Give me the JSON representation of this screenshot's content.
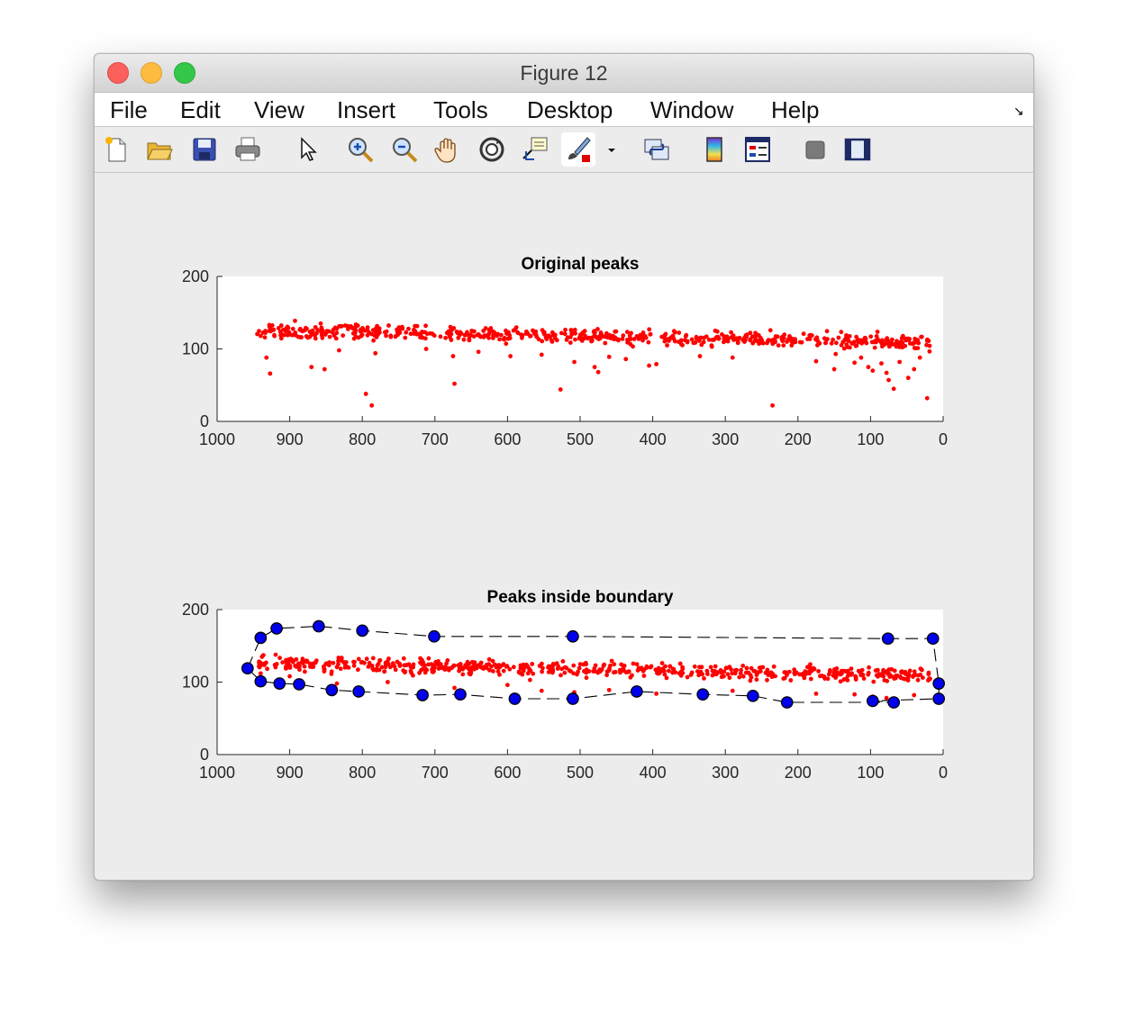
{
  "window": {
    "title": "Figure 12"
  },
  "menu": [
    "File",
    "Edit",
    "View",
    "Insert",
    "Tools",
    "Desktop",
    "Window",
    "Help"
  ],
  "toolbar_icons": [
    "new-figure-icon",
    "open-file-icon",
    "save-icon",
    "print-icon",
    "pointer-icon",
    "zoom-in-icon",
    "zoom-out-icon",
    "pan-icon",
    "rotate-3d-icon",
    "data-cursor-icon",
    "brush-icon",
    "brush-dropdown-icon",
    "link-plot-icon",
    "colorbar-icon",
    "legend-icon",
    "hide-plot-tools-icon",
    "show-plot-tools-icon"
  ],
  "colors": {
    "peaks": "#ff0000",
    "boundary_marker": "#0000ee",
    "boundary_line": "#000000",
    "axes_bg": "#ffffff",
    "figure_bg": "#ececec"
  },
  "chart_data": [
    {
      "type": "scatter",
      "title": "Original peaks",
      "xlabel": "",
      "ylabel": "",
      "xlim": [
        1000,
        0
      ],
      "x_reversed": true,
      "ylim": [
        0,
        200
      ],
      "xticks": [
        1000,
        900,
        800,
        700,
        600,
        500,
        400,
        300,
        200,
        100,
        0
      ],
      "yticks": [
        0,
        100,
        200
      ],
      "grid": false,
      "series": [
        {
          "trend": {
            "x_range": [
              945,
              18
            ],
            "y_start": 126,
            "y_end": 109,
            "spread": 9,
            "count": 620
          },
          "outliers": [
            {
              "x": 940,
              "y": 118
            },
            {
              "x": 932,
              "y": 88
            },
            {
              "x": 927,
              "y": 66
            },
            {
              "x": 870,
              "y": 75
            },
            {
              "x": 852,
              "y": 72
            },
            {
              "x": 832,
              "y": 98
            },
            {
              "x": 795,
              "y": 38
            },
            {
              "x": 787,
              "y": 22
            },
            {
              "x": 782,
              "y": 94
            },
            {
              "x": 712,
              "y": 100
            },
            {
              "x": 675,
              "y": 90
            },
            {
              "x": 673,
              "y": 52
            },
            {
              "x": 640,
              "y": 96
            },
            {
              "x": 596,
              "y": 90
            },
            {
              "x": 553,
              "y": 92
            },
            {
              "x": 527,
              "y": 44
            },
            {
              "x": 508,
              "y": 82
            },
            {
              "x": 480,
              "y": 75
            },
            {
              "x": 475,
              "y": 68
            },
            {
              "x": 460,
              "y": 89
            },
            {
              "x": 437,
              "y": 86
            },
            {
              "x": 405,
              "y": 77
            },
            {
              "x": 395,
              "y": 79
            },
            {
              "x": 335,
              "y": 90
            },
            {
              "x": 290,
              "y": 88
            },
            {
              "x": 235,
              "y": 22
            },
            {
              "x": 175,
              "y": 83
            },
            {
              "x": 148,
              "y": 93
            },
            {
              "x": 122,
              "y": 81
            },
            {
              "x": 113,
              "y": 88
            },
            {
              "x": 103,
              "y": 75
            },
            {
              "x": 97,
              "y": 70
            },
            {
              "x": 85,
              "y": 80
            },
            {
              "x": 78,
              "y": 67
            },
            {
              "x": 75,
              "y": 57
            },
            {
              "x": 68,
              "y": 45
            },
            {
              "x": 60,
              "y": 82
            },
            {
              "x": 48,
              "y": 60
            },
            {
              "x": 40,
              "y": 72
            },
            {
              "x": 32,
              "y": 88
            },
            {
              "x": 22,
              "y": 32
            },
            {
              "x": 150,
              "y": 72
            }
          ]
        }
      ]
    },
    {
      "type": "scatter",
      "title": "Peaks inside boundary",
      "xlabel": "",
      "ylabel": "",
      "xlim": [
        1000,
        0
      ],
      "x_reversed": true,
      "ylim": [
        0,
        200
      ],
      "xticks": [
        1000,
        900,
        800,
        700,
        600,
        500,
        400,
        300,
        200,
        100,
        0
      ],
      "yticks": [
        0,
        100,
        200
      ],
      "grid": false,
      "series": [
        {
          "trend": {
            "x_range": [
              945,
              18
            ],
            "y_start": 126,
            "y_end": 109,
            "spread": 9,
            "count": 600
          },
          "outliers": [
            {
              "x": 940,
              "y": 112
            },
            {
              "x": 900,
              "y": 108
            },
            {
              "x": 835,
              "y": 98
            },
            {
              "x": 765,
              "y": 100
            },
            {
              "x": 712,
              "y": 85
            },
            {
              "x": 673,
              "y": 92
            },
            {
              "x": 600,
              "y": 96
            },
            {
              "x": 553,
              "y": 88
            },
            {
              "x": 508,
              "y": 86
            },
            {
              "x": 460,
              "y": 89
            },
            {
              "x": 395,
              "y": 84
            },
            {
              "x": 290,
              "y": 88
            },
            {
              "x": 175,
              "y": 84
            },
            {
              "x": 122,
              "y": 83
            },
            {
              "x": 97,
              "y": 80
            },
            {
              "x": 78,
              "y": 78
            },
            {
              "x": 40,
              "y": 82
            }
          ]
        },
        {
          "boundary": [
            {
              "x": 958,
              "y": 119
            },
            {
              "x": 940,
              "y": 161
            },
            {
              "x": 918,
              "y": 174
            },
            {
              "x": 860,
              "y": 177
            },
            {
              "x": 800,
              "y": 171
            },
            {
              "x": 701,
              "y": 163
            },
            {
              "x": 510,
              "y": 163
            },
            {
              "x": 76,
              "y": 160
            },
            {
              "x": 14,
              "y": 160
            },
            {
              "x": 6,
              "y": 98
            },
            {
              "x": 6,
              "y": 77
            },
            {
              "x": 97,
              "y": 74
            },
            {
              "x": 68,
              "y": 72
            },
            {
              "x": 215,
              "y": 72
            },
            {
              "x": 262,
              "y": 81
            },
            {
              "x": 331,
              "y": 83
            },
            {
              "x": 422,
              "y": 87
            },
            {
              "x": 510,
              "y": 77
            },
            {
              "x": 590,
              "y": 77
            },
            {
              "x": 665,
              "y": 83
            },
            {
              "x": 717,
              "y": 82
            },
            {
              "x": 805,
              "y": 87
            },
            {
              "x": 842,
              "y": 89
            },
            {
              "x": 887,
              "y": 97
            },
            {
              "x": 914,
              "y": 98
            },
            {
              "x": 940,
              "y": 101
            },
            {
              "x": 958,
              "y": 119
            }
          ]
        }
      ]
    }
  ]
}
